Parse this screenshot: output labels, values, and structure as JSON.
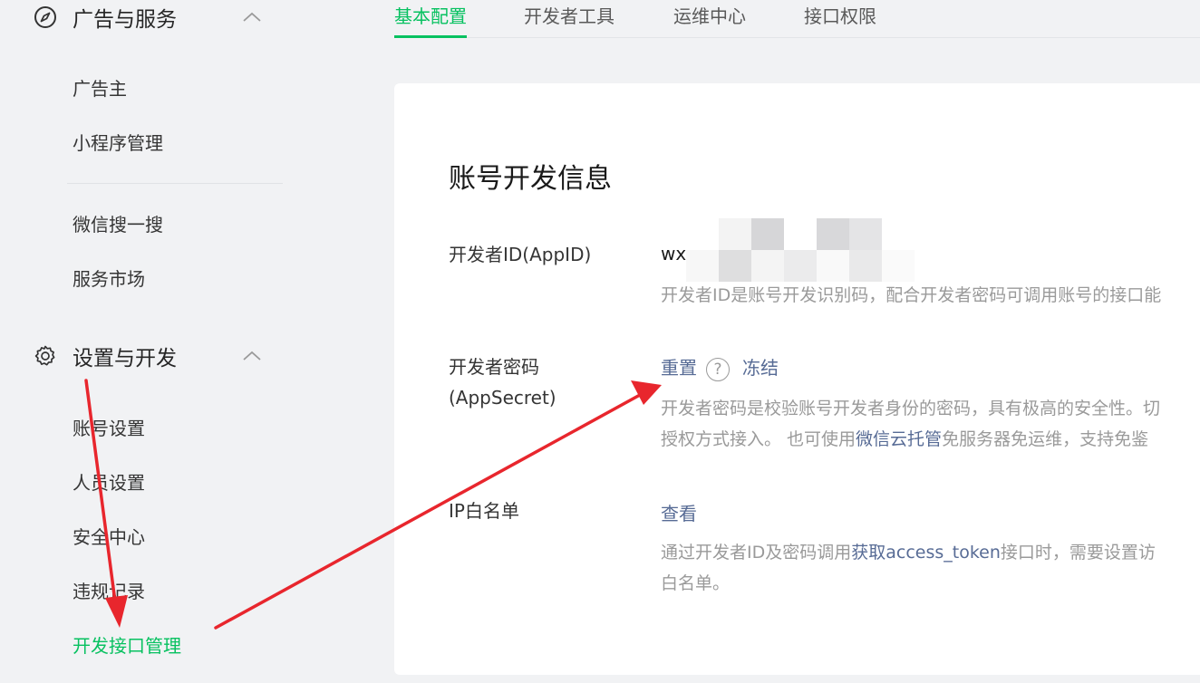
{
  "sidebar": {
    "group1": {
      "title": "广告与服务",
      "icon": "compass-icon",
      "chevron": "chevron-up-icon"
    },
    "group1_items": [
      "广告主",
      "小程序管理",
      "微信搜一搜",
      "服务市场"
    ],
    "group2": {
      "title": "设置与开发",
      "icon": "gear-icon",
      "chevron": "chevron-up-icon"
    },
    "group2_items": [
      "账号设置",
      "人员设置",
      "安全中心",
      "违规记录",
      "开发接口管理"
    ],
    "active_item": "开发接口管理"
  },
  "tabs": [
    "基本配置",
    "开发者工具",
    "运维中心",
    "接口权限"
  ],
  "active_tab": "基本配置",
  "card": {
    "title": "账号开发信息",
    "appid": {
      "label": "开发者ID(AppID)",
      "value_prefix": "wx",
      "desc": "开发者ID是账号开发识别码，配合开发者密码可调用账号的接口能"
    },
    "appsecret": {
      "label": "开发者密码(AppSecret)",
      "reset_label": "重置",
      "help_symbol": "?",
      "freeze_label": "冻结",
      "desc_line1": "开发者密码是校验账号开发者身份的密码，具有极高的安全性。切",
      "desc_line2_a": "授权方式接入。 也可使用",
      "desc_line2_link": "微信云托管",
      "desc_line2_b": "免服务器免运维，支持免鉴"
    },
    "ip_whitelist": {
      "label": "IP白名单",
      "view_label": "查看",
      "desc_line1_a": "通过开发者ID及密码调用",
      "desc_line1_link": "获取access_token",
      "desc_line1_b": "接口时，需要设置访",
      "desc_line2": "白名单。"
    }
  },
  "colors": {
    "accent": "#07c160",
    "link": "#576b95",
    "annotation_arrow": "#e8262d"
  }
}
